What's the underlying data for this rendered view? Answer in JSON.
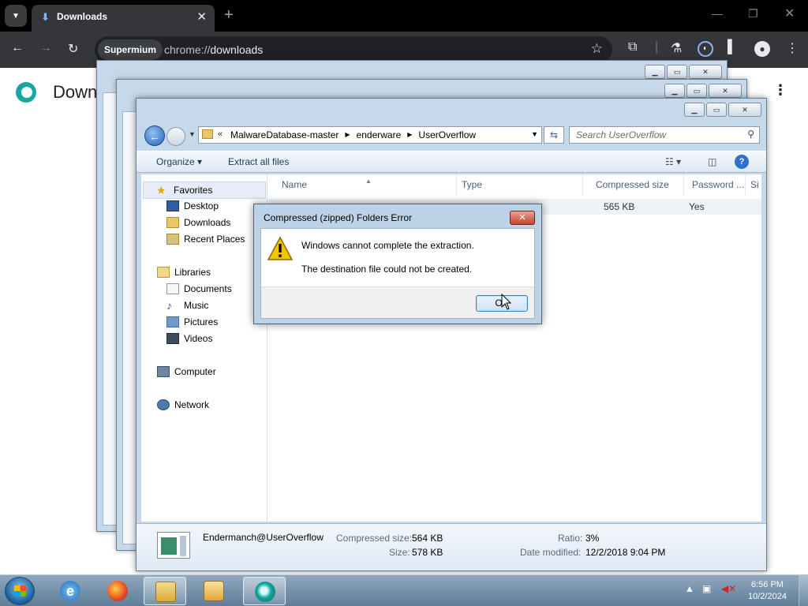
{
  "chrome": {
    "tab_title": "Downloads",
    "site_chip": "Supermium",
    "url_scheme": "chrome://",
    "url_host": "downloads",
    "accent": "#8ab4f8"
  },
  "page": {
    "title": "Down"
  },
  "explorer": {
    "breadcrumbs": [
      "MalwareDatabase-master",
      "enderware",
      "UserOverflow"
    ],
    "search_placeholder": "Search UserOverflow",
    "commands": {
      "organize": "Organize",
      "extract_all": "Extract all files"
    },
    "nav": {
      "favorites": "Favorites",
      "desktop": "Desktop",
      "downloads": "Downloads",
      "recent_places": "Recent Places",
      "libraries": "Libraries",
      "documents": "Documents",
      "music": "Music",
      "pictures": "Pictures",
      "videos": "Videos",
      "computer": "Computer",
      "network": "Network"
    },
    "columns": {
      "name": "Name",
      "type": "Type",
      "compressed_size": "Compressed size",
      "password": "Password ...",
      "size_abbr": "Si"
    },
    "file_row": {
      "compressed_size": "565 KB",
      "password": "Yes"
    },
    "details": {
      "name": "Endermanch@UserOverflow",
      "compressed_size_label": "Compressed size:",
      "compressed_size": "564 KB",
      "size_label": "Size:",
      "size": "578 KB",
      "ratio_label": "Ratio:",
      "ratio": "3%",
      "date_label": "Date modified:",
      "date": "12/2/2018 9:04 PM"
    }
  },
  "dialog": {
    "title": "Compressed (zipped) Folders Error",
    "message_1": "Windows cannot complete the extraction.",
    "message_2": "The destination file could not be created.",
    "ok_label": "OK"
  },
  "taskbar": {
    "time": "6:56 PM",
    "date": "10/2/2024"
  }
}
